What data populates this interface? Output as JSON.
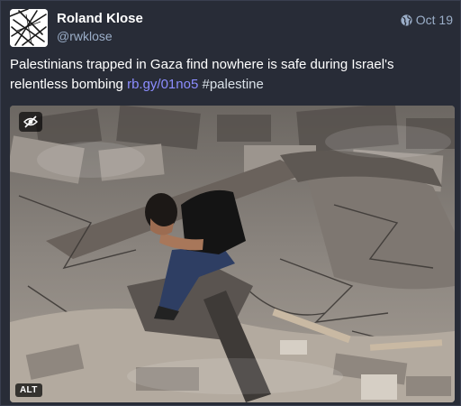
{
  "author": {
    "display_name": "Roland Klose",
    "handle": "@rwklose"
  },
  "meta": {
    "visibility_icon": "globe-icon",
    "date": "Oct 19"
  },
  "post": {
    "text": "Palestinians trapped in Gaza find nowhere is safe during Israel's relentless bombing ",
    "link": "rb.gy/01no5",
    "hashtag": "#palestine"
  },
  "media": {
    "hide_icon": "eye-slash-icon",
    "alt_label": "ALT"
  },
  "colors": {
    "background": "#282c37",
    "handle": "#9baec8",
    "link": "#8c8dff"
  }
}
